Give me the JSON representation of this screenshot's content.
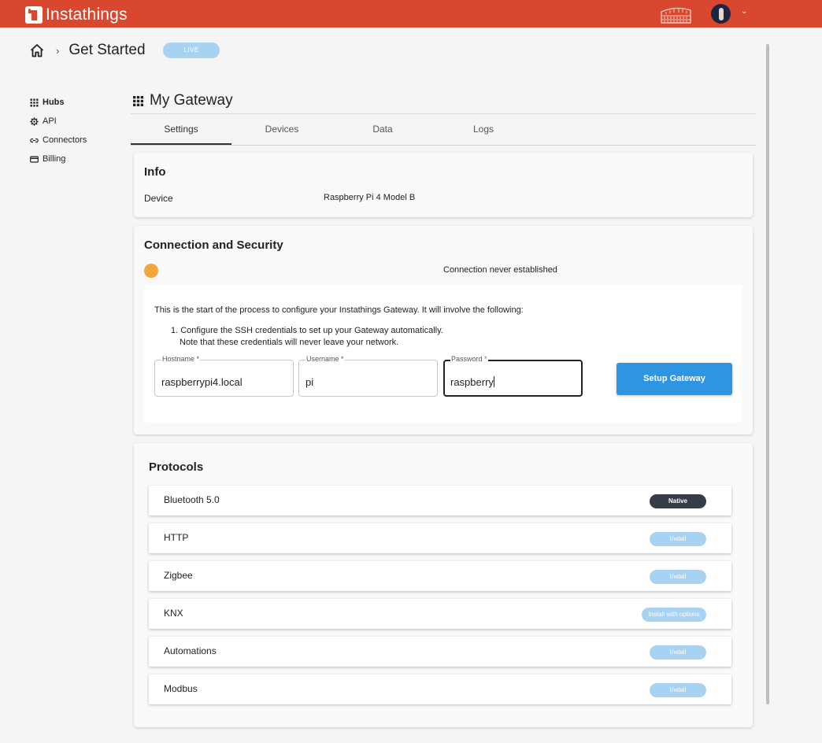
{
  "app": {
    "name": "Instathings"
  },
  "header": {
    "avatar_caret": "⌄"
  },
  "breadcrumb": {
    "separator": "›",
    "title": "Get Started",
    "badge": "LIVE"
  },
  "sidebar": {
    "items": [
      {
        "label": "Hubs",
        "icon": "grid-icon",
        "active": true
      },
      {
        "label": "API",
        "icon": "gear-icon",
        "active": false
      },
      {
        "label": "Connectors",
        "icon": "link-icon",
        "active": false
      },
      {
        "label": "Billing",
        "icon": "credit-card-icon",
        "active": false
      }
    ]
  },
  "gateway": {
    "title": "My Gateway",
    "tabs": [
      {
        "label": "Settings",
        "active": true
      },
      {
        "label": "Devices",
        "active": false
      },
      {
        "label": "Data",
        "active": false
      },
      {
        "label": "Logs",
        "active": false
      }
    ]
  },
  "info": {
    "title": "Info",
    "device_label": "Device",
    "device_value": "Raspberry Pi 4 Model B"
  },
  "connection": {
    "title": "Connection and Security",
    "status_color": "#f3a63a",
    "status_text": "Connection never established",
    "intro": "This is the start of the process to configure your Instathings Gateway. It will involve the following:",
    "step1_line1": "1. Configure the SSH credentials to set up your Gateway automatically.",
    "step1_line2": "Note that these credentials will never leave your network.",
    "fields": {
      "hostname": {
        "label": "Hostname",
        "required": "*",
        "value": "raspberrypi4.local"
      },
      "username": {
        "label": "Username",
        "required": "*",
        "value": "pi"
      },
      "password": {
        "label": "Password",
        "required": "*",
        "value": "raspberry"
      }
    },
    "setup_button": "Setup Gateway"
  },
  "protocols": {
    "title": "Protocols",
    "items": [
      {
        "name": "Bluetooth 5.0",
        "action": "Native"
      },
      {
        "name": "HTTP",
        "action": "Install"
      },
      {
        "name": "Zigbee",
        "action": "Install"
      },
      {
        "name": "KNX",
        "action": "Install with options"
      },
      {
        "name": "Automations",
        "action": "Install"
      },
      {
        "name": "Modbus",
        "action": "Install"
      }
    ]
  },
  "colors": {
    "brand": "#d9482e",
    "primary_button": "#2e95e3",
    "badge_light": "#a8d2f2",
    "native_badge": "#373d48"
  }
}
